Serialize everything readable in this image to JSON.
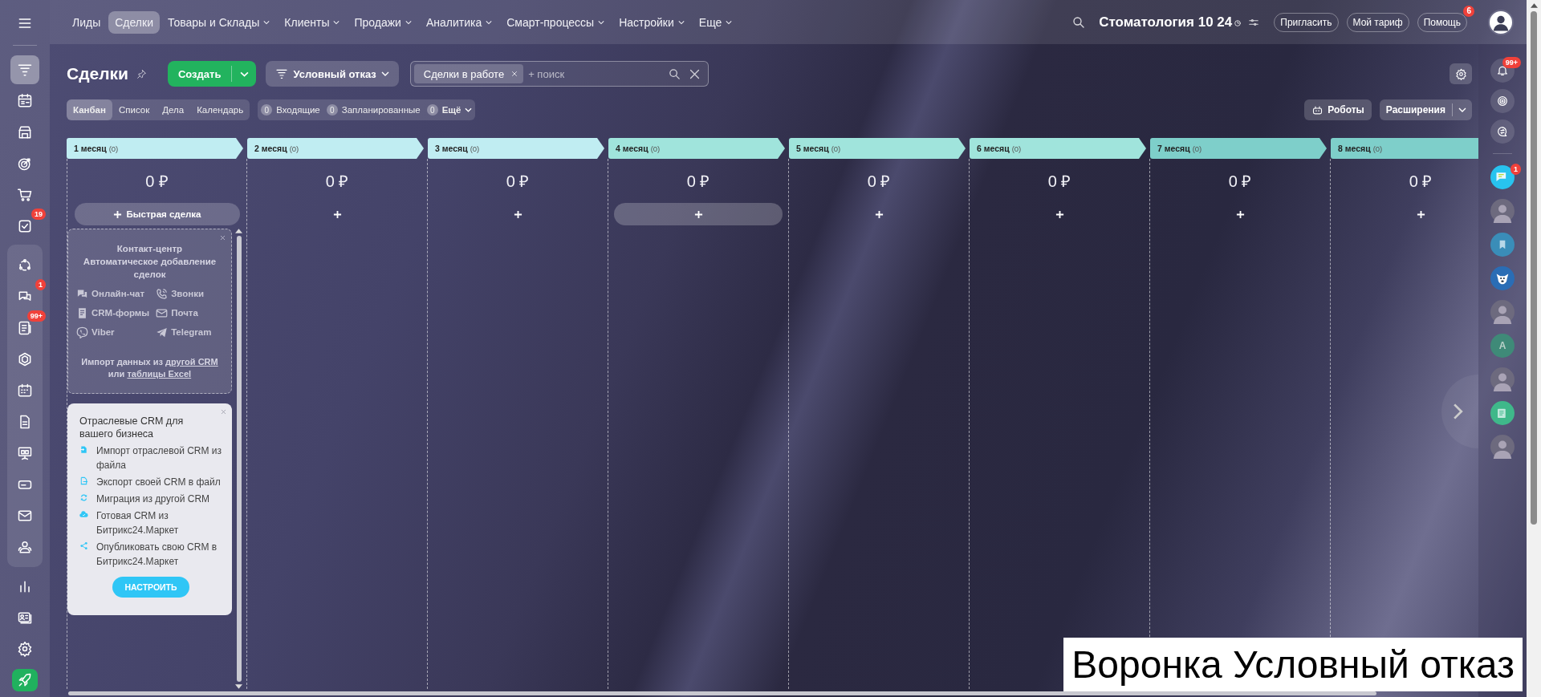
{
  "left_sidebar": {
    "top_items": [
      {
        "kind": "filter",
        "selected": true
      },
      {
        "kind": "calendar-list",
        "selected": false
      },
      {
        "kind": "store",
        "selected": false
      },
      {
        "kind": "target",
        "selected": false
      },
      {
        "kind": "cart",
        "selected": false
      },
      {
        "kind": "task",
        "selected": false,
        "badge": "19"
      }
    ],
    "group_items": [
      {
        "kind": "cycle",
        "selected": false
      },
      {
        "kind": "chat",
        "selected": false,
        "badge": "1"
      },
      {
        "kind": "news",
        "selected": false,
        "badge": "99+"
      },
      {
        "kind": "hexagon",
        "selected": false
      },
      {
        "kind": "calendar",
        "selected": false
      },
      {
        "kind": "document",
        "selected": false
      },
      {
        "kind": "presentation",
        "selected": false
      },
      {
        "kind": "terminal",
        "selected": false
      },
      {
        "kind": "mail",
        "selected": false
      },
      {
        "kind": "people",
        "selected": false
      }
    ],
    "bottom_items": [
      {
        "kind": "chart",
        "selected": false
      },
      {
        "kind": "contact-card",
        "selected": false
      },
      {
        "kind": "gear",
        "selected": false
      },
      {
        "kind": "rocket",
        "selected": false
      }
    ]
  },
  "top_nav": [
    {
      "label": "Лиды",
      "selected": false,
      "dropdown": false
    },
    {
      "label": "Сделки",
      "selected": true,
      "dropdown": false
    },
    {
      "label": "Товары и Склады",
      "selected": false,
      "dropdown": true
    },
    {
      "label": "Клиенты",
      "selected": false,
      "dropdown": true
    },
    {
      "label": "Продажи",
      "selected": false,
      "dropdown": true
    },
    {
      "label": "Аналитика",
      "selected": false,
      "dropdown": true
    },
    {
      "label": "Смарт-процессы",
      "selected": false,
      "dropdown": true
    },
    {
      "label": "Настройки",
      "selected": false,
      "dropdown": true
    },
    {
      "label": "Еще",
      "selected": false,
      "dropdown": true
    }
  ],
  "portal": {
    "name": "Стоматология 10 24"
  },
  "header_buttons": [
    {
      "label": "Пригласить"
    },
    {
      "label": "Мой тариф"
    },
    {
      "label": "Помощь",
      "badge": "6"
    }
  ],
  "page": {
    "title": "Сделки",
    "create_button": "Создать",
    "funnel": "Условный отказ",
    "filter_chip": "Сделки в работе",
    "search_placeholder": "+ поиск"
  },
  "view_tabs": [
    {
      "label": "Канбан",
      "selected": true
    },
    {
      "label": "Список",
      "selected": false
    },
    {
      "label": "Дела",
      "selected": false
    },
    {
      "label": "Календарь",
      "selected": false
    }
  ],
  "counters": [
    {
      "count": "0",
      "label": "Входящие",
      "dropdown": false
    },
    {
      "count": "0",
      "label": "Запланированные",
      "dropdown": false
    },
    {
      "count": "0",
      "label": "Ещё",
      "dropdown": true
    }
  ],
  "robots_button": "Роботы",
  "extensions_button": "Расширения",
  "stages": [
    {
      "name": "1 месяц",
      "count": "(0)",
      "sum": "0 ₽",
      "color": "#c0edf2",
      "quick_add": "Быстрая сделка",
      "highlighted": false
    },
    {
      "name": "2 месяц",
      "count": "(0)",
      "sum": "0 ₽",
      "color": "#c0edf2",
      "highlighted": false
    },
    {
      "name": "3 месяц",
      "count": "(0)",
      "sum": "0 ₽",
      "color": "#c0edf2",
      "highlighted": false
    },
    {
      "name": "4 месяц",
      "count": "(0)",
      "sum": "0 ₽",
      "color": "#a0e4dc",
      "highlighted": true
    },
    {
      "name": "5 месяц",
      "count": "(0)",
      "sum": "0 ₽",
      "color": "#a0e4dc",
      "highlighted": false
    },
    {
      "name": "6 месяц",
      "count": "(0)",
      "sum": "0 ₽",
      "color": "#a0e4dc",
      "highlighted": false
    },
    {
      "name": "7 месяц",
      "count": "(0)",
      "sum": "0 ₽",
      "color": "#7ecfca",
      "highlighted": false
    },
    {
      "name": "8 месяц",
      "count": "(0)",
      "sum": "0 ₽",
      "color": "#7ecfca",
      "highlighted": false
    }
  ],
  "contact_center": {
    "title": "Контакт-центр",
    "subtitle": "Автоматическое добавление сделок",
    "channels": [
      {
        "kind": "chat",
        "label": "Онлайн-чат"
      },
      {
        "kind": "phone",
        "label": "Звонки"
      },
      {
        "kind": "form",
        "label": "CRM-формы"
      },
      {
        "kind": "mail",
        "label": "Почта"
      },
      {
        "kind": "viber",
        "label": "Viber"
      },
      {
        "kind": "telegram",
        "label": "Telegram"
      }
    ],
    "import_prefix": "Импорт данных из",
    "import_link_1": "другой CRM",
    "import_middle": "или",
    "import_link_2": "таблицы Excel"
  },
  "industry_crm": {
    "title": "Отраслевые CRM для вашего бизнеса",
    "items": [
      {
        "kind": "import",
        "label": "Импорт отраслевой CRM из файла"
      },
      {
        "kind": "export",
        "label": "Экспорт своей CRM в файл"
      },
      {
        "kind": "migrate",
        "label": "Миграция из другой CRM"
      },
      {
        "kind": "cloud",
        "label": "Готовая CRM из Битрикс24.Маркет"
      },
      {
        "kind": "share",
        "label": "Опубликовать свою CRM в Битрикс24.Маркет"
      }
    ],
    "button": "НАСТРОИТЬ"
  },
  "right_sidebar": {
    "notifications_badge": "99+",
    "contacts": [
      {
        "kind": "chat",
        "badge": "1"
      },
      {
        "kind": "photo"
      },
      {
        "kind": "bookmark"
      },
      {
        "kind": "dog"
      },
      {
        "kind": "photo"
      },
      {
        "kind": "letter",
        "letter": "A"
      },
      {
        "kind": "photo"
      },
      {
        "kind": "news"
      },
      {
        "kind": "photo"
      }
    ]
  },
  "caption": "Воронка Условный отказ"
}
